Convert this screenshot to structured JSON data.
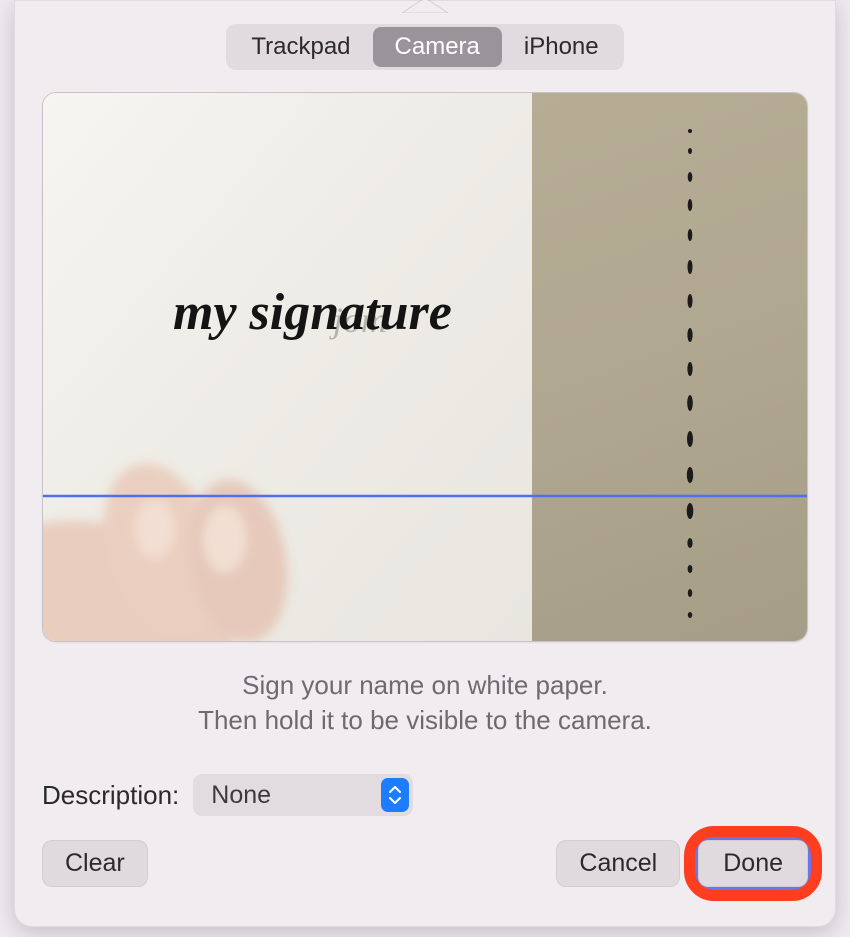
{
  "tabs": {
    "items": [
      {
        "label": "Trackpad",
        "active": false
      },
      {
        "label": "Camera",
        "active": true
      },
      {
        "label": "iPhone",
        "active": false
      }
    ]
  },
  "preview": {
    "signature_text": "my signature",
    "ghost_text": "jom"
  },
  "instructions": {
    "line1": "Sign your name on white paper.",
    "line2": "Then hold it to be visible to the camera."
  },
  "description": {
    "label": "Description:",
    "selected": "None"
  },
  "buttons": {
    "clear": "Clear",
    "cancel": "Cancel",
    "done": "Done"
  },
  "colors": {
    "accent_blue": "#1e7cff",
    "guide_line": "#4f6ff0",
    "highlight_ring": "#ff3e1f",
    "focus_ring": "#6a76e8"
  }
}
